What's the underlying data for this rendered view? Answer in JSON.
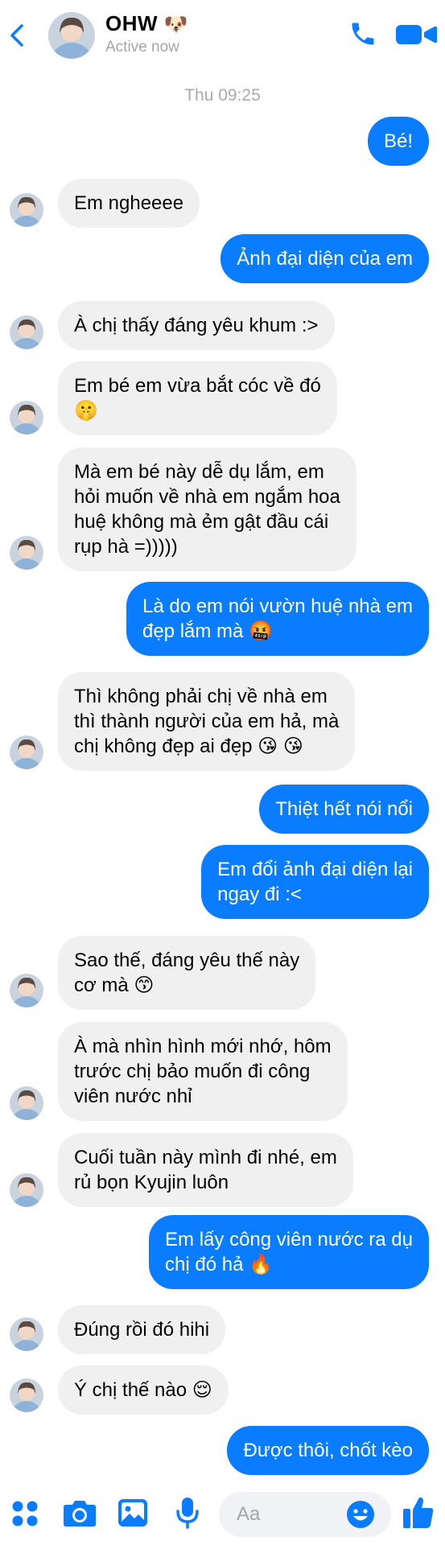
{
  "header": {
    "contact_name": "OHW",
    "name_emoji": "🐶",
    "status": "Active now",
    "icons": [
      "back-chevron-icon",
      "phone-icon",
      "video-camera-icon"
    ]
  },
  "timestamp": "Thu 09:25",
  "messages": [
    {
      "dir": "out",
      "lines": [
        "Bé!"
      ]
    },
    {
      "dir": "in",
      "lines": [
        "Em ngheeee"
      ]
    },
    {
      "dir": "out",
      "lines": [
        "Ảnh đại diện của em"
      ]
    },
    {
      "dir": "in",
      "lines": [
        "À chị thấy đáng yêu khum :>"
      ]
    },
    {
      "dir": "in",
      "lines": [
        "Em bé em vừa bắt cóc về đó",
        "🤫"
      ]
    },
    {
      "dir": "in",
      "lines": [
        "Mà em bé này dễ dụ lắm, em",
        "hỏi muốn về nhà em ngắm hoa",
        "huệ không mà ẻm gật đầu cái",
        "rụp hà =)))))"
      ]
    },
    {
      "dir": "out",
      "lines": [
        "Là do em nói vườn huệ nhà em",
        "đẹp lắm mà 🤬"
      ]
    },
    {
      "dir": "in",
      "lines": [
        "Thì không phải chị về nhà em",
        "thì thành người của em hả, mà",
        "chị không đẹp ai đẹp 😘 😘"
      ]
    },
    {
      "dir": "out",
      "lines": [
        "Thiệt hết nói nổi"
      ]
    },
    {
      "dir": "out",
      "lines": [
        "Em đổi ảnh đại diện lại",
        "ngay đi :<"
      ]
    },
    {
      "dir": "in",
      "lines": [
        "Sao thế, đáng yêu thế này",
        "cơ mà 😙"
      ]
    },
    {
      "dir": "in",
      "lines": [
        "À mà nhìn hình mới nhớ, hôm",
        "trước chị bảo muốn đi công",
        "viên nước nhỉ"
      ]
    },
    {
      "dir": "in",
      "lines": [
        "Cuối tuần này mình đi nhé, em",
        "rủ bọn Kyujin luôn"
      ]
    },
    {
      "dir": "out",
      "lines": [
        "Em lấy công viên nước ra dụ",
        "chị đó hả 🔥"
      ]
    },
    {
      "dir": "in",
      "lines": [
        "Đúng rồi đó hihi"
      ]
    },
    {
      "dir": "in",
      "lines": [
        "Ý chị thế nào 😌"
      ]
    },
    {
      "dir": "out",
      "lines": [
        "Được thôi, chốt kèo"
      ]
    }
  ],
  "composer": {
    "placeholder": "Aa",
    "icons": [
      "apps-grid-icon",
      "camera-icon",
      "gallery-icon",
      "microphone-icon",
      "emoji-icon",
      "like-thumb-icon"
    ]
  },
  "colors": {
    "accent": "#0a7cff",
    "incoming_bubble": "#f0f0f0",
    "muted_text": "#a3a7ad"
  }
}
